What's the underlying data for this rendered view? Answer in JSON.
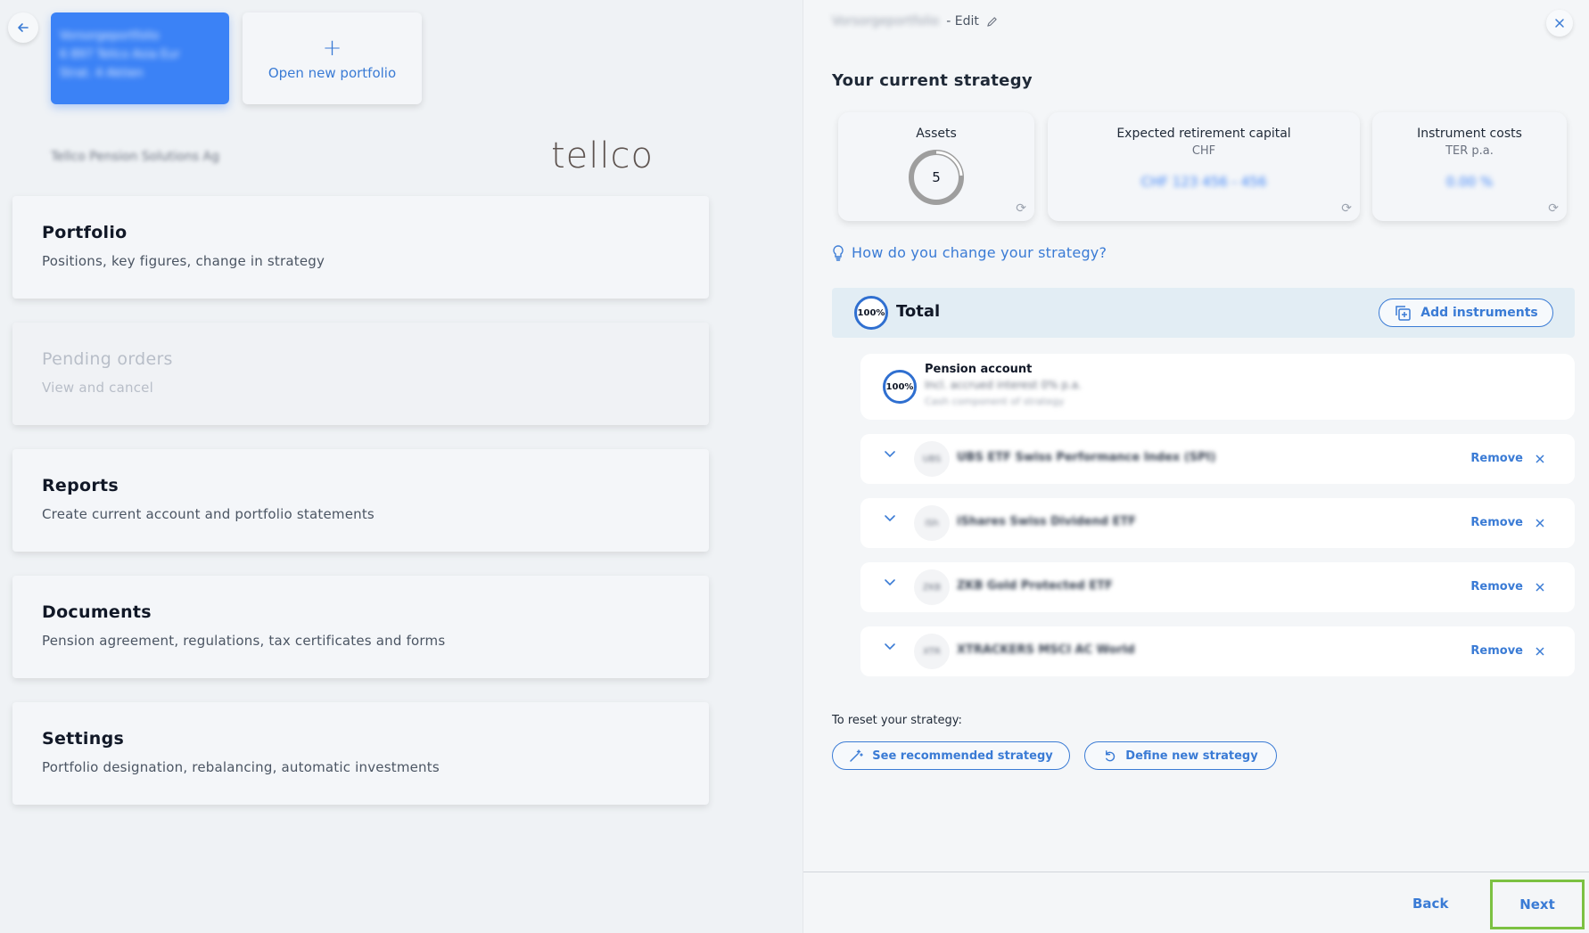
{
  "left": {
    "back_icon": "arrow-left-icon",
    "portfolio_card": {
      "line1": "Vorsorgeportfolio",
      "line2": "6 897 Tellco Asia Eur",
      "line3": "Strat. 4 Aktien"
    },
    "open_new_label": "Open new portfolio",
    "provider": "Tellco Pension Solutions Ag",
    "logo": "tellco",
    "menu": [
      {
        "title": "Portfolio",
        "subtitle": "Positions, key figures, change in strategy"
      },
      {
        "title": "Pending orders",
        "subtitle": "View and cancel"
      },
      {
        "title": "Reports",
        "subtitle": "Create current account and portfolio statements"
      },
      {
        "title": "Documents",
        "subtitle": "Pension agreement, regulations, tax certificates and forms"
      },
      {
        "title": "Settings",
        "subtitle": "Portfolio designation, rebalancing, automatic investments"
      }
    ]
  },
  "right": {
    "portfolio_name": "Vorsorgeportfolio",
    "edit_label": "- Edit",
    "section_title": "Your current strategy",
    "kpis": {
      "assets": {
        "title": "Assets",
        "value": "5"
      },
      "retirement": {
        "title": "Expected retirement capital",
        "currency": "CHF",
        "value": "CHF 123 456 - 456"
      },
      "costs": {
        "title": "Instrument costs",
        "subtitle": "TER p.a.",
        "value": "0.00 %"
      }
    },
    "hint": "How do you change your strategy?",
    "total": {
      "percent": "100%",
      "label": "Total",
      "add_label": "Add instruments"
    },
    "pension": {
      "percent": "100%",
      "title": "Pension account",
      "line1": "Incl. accrued interest 0% p.a.",
      "line2": "Cash component of strategy"
    },
    "instruments": [
      {
        "abbr": "UBS",
        "name": "UBS ETF Swiss Performance Index (SPI)",
        "remove": "Remove"
      },
      {
        "abbr": "iSh",
        "name": "iShares Swiss Dividend ETF",
        "remove": "Remove"
      },
      {
        "abbr": "ZKB",
        "name": "ZKB Gold Protected ETF",
        "remove": "Remove"
      },
      {
        "abbr": "XTR",
        "name": "XTRACKERS MSCI AC World",
        "remove": "Remove"
      }
    ],
    "reset_label": "To reset your strategy:",
    "recommended_label": "See recommended strategy",
    "define_label": "Define new strategy",
    "back_label": "Back",
    "next_label": "Next"
  }
}
